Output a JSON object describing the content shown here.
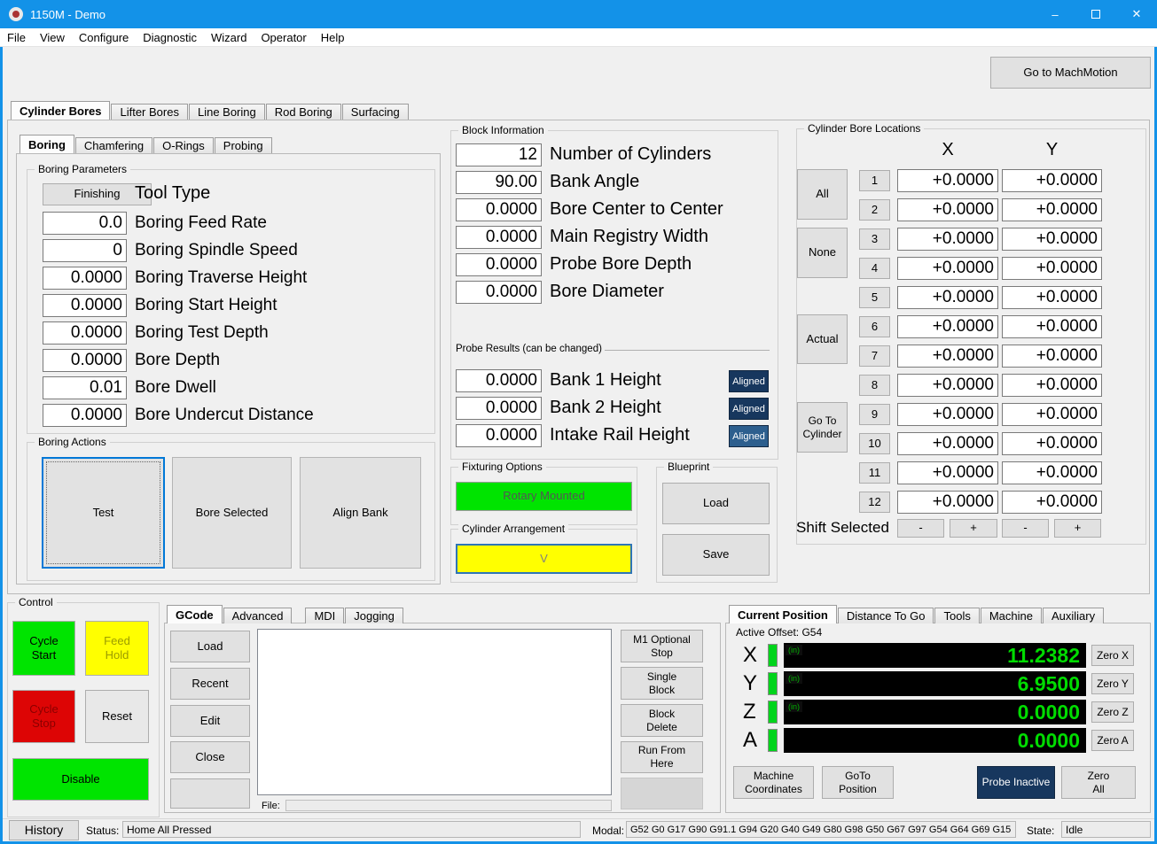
{
  "window": {
    "title": "1150M - Demo"
  },
  "icons": {
    "minimize": "–",
    "close": "✕"
  },
  "colors": {
    "titlebar": "#1392e8",
    "green": "#00e400",
    "yellow": "#ffff00",
    "red": "#dd0505",
    "navy": "#17375e",
    "dro_green": "#00dc00"
  },
  "menu": {
    "items": [
      "File",
      "View",
      "Configure",
      "Diagnostic",
      "Wizard",
      "Operator",
      "Help"
    ]
  },
  "header": {
    "goto_machmotion": "Go to MachMotion"
  },
  "main_tabs": {
    "items": [
      "Cylinder Bores",
      "Lifter Bores",
      "Line Boring",
      "Rod Boring",
      "Surfacing"
    ]
  },
  "sub_tabs": {
    "items": [
      "Boring",
      "Chamfering",
      "O-Rings",
      "Probing"
    ]
  },
  "boring_parameters": {
    "title": "Boring Parameters",
    "finishing": "Finishing",
    "tool_type": "Tool Type",
    "fields": [
      {
        "value": "0.0",
        "label": "Boring Feed Rate"
      },
      {
        "value": "0",
        "label": "Boring Spindle Speed"
      },
      {
        "value": "0.0000",
        "label": "Boring Traverse Height"
      },
      {
        "value": "0.0000",
        "label": "Boring Start Height"
      },
      {
        "value": "0.0000",
        "label": "Boring Test Depth"
      },
      {
        "value": "0.0000",
        "label": "Bore Depth"
      },
      {
        "value": "0.01",
        "label": "Bore Dwell"
      },
      {
        "value": "0.0000",
        "label": "Bore Undercut Distance"
      }
    ]
  },
  "boring_actions": {
    "title": "Boring Actions",
    "buttons": [
      "Test",
      "Bore Selected",
      "Align Bank"
    ]
  },
  "block_information": {
    "title": "Block Information",
    "fields": [
      {
        "value": "12",
        "label": "Number of Cylinders"
      },
      {
        "value": "90.00",
        "label": "Bank Angle"
      },
      {
        "value": "0.0000",
        "label": "Bore Center to Center"
      },
      {
        "value": "0.0000",
        "label": "Main Registry Width"
      },
      {
        "value": "0.0000",
        "label": "Probe Bore Depth"
      },
      {
        "value": "0.0000",
        "label": "Bore Diameter"
      }
    ],
    "probe_results": {
      "title": "Probe Results (can be changed)",
      "rows": [
        {
          "value": "0.0000",
          "label": "Bank 1 Height",
          "button": "Aligned"
        },
        {
          "value": "0.0000",
          "label": "Bank 2 Height",
          "button": "Aligned"
        },
        {
          "value": "0.0000",
          "label": "Intake Rail Height",
          "button": "Aligned"
        }
      ]
    }
  },
  "fixturing": {
    "title": "Fixturing Options",
    "rotary": "Rotary Mounted"
  },
  "arrangement": {
    "title": "Cylinder Arrangement",
    "value": "V"
  },
  "blueprint": {
    "title": "Blueprint",
    "load": "Load",
    "save": "Save"
  },
  "bore_locations": {
    "title": "Cylinder Bore Locations",
    "col_x": "X",
    "col_y": "Y",
    "side": [
      "All",
      "None",
      "Actual",
      "Go To\nCylinder"
    ],
    "rows": [
      {
        "n": "1",
        "x": "+0.0000",
        "y": "+0.0000"
      },
      {
        "n": "2",
        "x": "+0.0000",
        "y": "+0.0000"
      },
      {
        "n": "3",
        "x": "+0.0000",
        "y": "+0.0000"
      },
      {
        "n": "4",
        "x": "+0.0000",
        "y": "+0.0000"
      },
      {
        "n": "5",
        "x": "+0.0000",
        "y": "+0.0000"
      },
      {
        "n": "6",
        "x": "+0.0000",
        "y": "+0.0000"
      },
      {
        "n": "7",
        "x": "+0.0000",
        "y": "+0.0000"
      },
      {
        "n": "8",
        "x": "+0.0000",
        "y": "+0.0000"
      },
      {
        "n": "9",
        "x": "+0.0000",
        "y": "+0.0000"
      },
      {
        "n": "10",
        "x": "+0.0000",
        "y": "+0.0000"
      },
      {
        "n": "11",
        "x": "+0.0000",
        "y": "+0.0000"
      },
      {
        "n": "12",
        "x": "+0.0000",
        "y": "+0.0000"
      }
    ],
    "shift_label": "Shift Selected",
    "shift": [
      "-",
      "+",
      "-",
      "+"
    ]
  },
  "control": {
    "title": "Control",
    "cycle_start": "Cycle\nStart",
    "feed_hold": "Feed\nHold",
    "cycle_stop": "Cycle\nStop",
    "reset": "Reset",
    "disable": "Disable"
  },
  "gcode": {
    "tabs": [
      "GCode",
      "Advanced",
      "MDI",
      "Jogging"
    ],
    "left_buttons": [
      "Load",
      "Recent",
      "Edit",
      "Close"
    ],
    "right_buttons": [
      "M1 Optional\nStop",
      "Single\nBlock",
      "Block\nDelete",
      "Run From\nHere"
    ],
    "file_label": "File:"
  },
  "position": {
    "tabs": [
      "Current Position",
      "Distance To Go",
      "Tools",
      "Machine",
      "Auxiliary"
    ],
    "active_offset": "Active Offset: G54",
    "axes": [
      {
        "axis": "X",
        "unit": "(in)",
        "value": "11.2382",
        "zero": "Zero X"
      },
      {
        "axis": "Y",
        "unit": "(in)",
        "value": "6.9500",
        "zero": "Zero Y"
      },
      {
        "axis": "Z",
        "unit": "(in)",
        "value": "0.0000",
        "zero": "Zero Z"
      },
      {
        "axis": "A",
        "unit": "",
        "value": "0.0000",
        "zero": "Zero A"
      }
    ],
    "machine_coords": "Machine\nCoordinates",
    "goto_position": "GoTo\nPosition",
    "probe": "Probe Inactive",
    "zero_all": "Zero\nAll"
  },
  "status": {
    "history": "History",
    "status_label": "Status:",
    "status_value": "Home All Pressed",
    "modal_label": "Modal:",
    "modal_value": "G52 G0 G17 G90 G91.1 G94 G20 G40 G49 G80 G98 G50 G67 G97 G54 G64 G69 G15",
    "state_label": "State:",
    "state_value": "Idle"
  }
}
